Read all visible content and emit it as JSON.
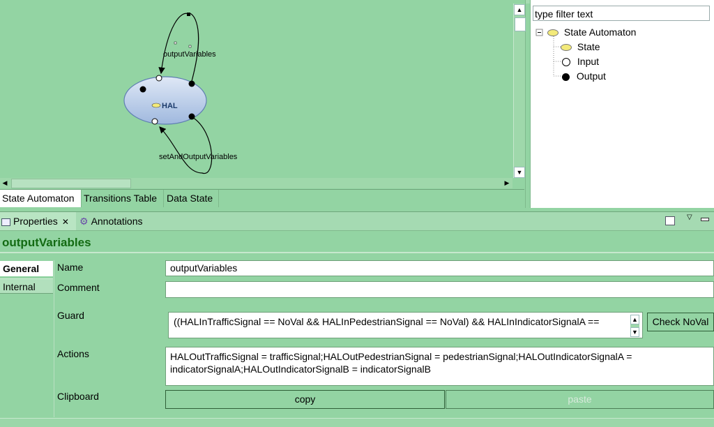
{
  "diagram": {
    "node_label": "HAL",
    "transition_top_label": "outputVariables",
    "transition_bottom_label": "setAndOutputVariables"
  },
  "editor_tabs": [
    "State Automaton",
    "Transitions Table",
    "Data State"
  ],
  "outline": {
    "filter_placeholder": "type filter text",
    "root": "State Automaton",
    "children": [
      "State",
      "Input",
      "Output"
    ],
    "toggle": "⊟"
  },
  "properties": {
    "tabs": [
      "Properties",
      "Annotations"
    ],
    "title": "outputVariables",
    "nav": [
      "General",
      "Internal"
    ],
    "labels": {
      "name": "Name",
      "comment": "Comment",
      "guard": "Guard",
      "actions": "Actions",
      "clipboard": "Clipboard"
    },
    "name_value": "outputVariables",
    "comment_value": "",
    "guard_value": "((HALInTrafficSignal == NoVal && HALInPedestrianSignal == NoVal) && HALInIndicatorSignalA ==",
    "actions_value": "HALOutTrafficSignal = trafficSignal;HALOutPedestrianSignal = pedestrianSignal;HALOutIndicatorSignalA = indicatorSignalA;HALOutIndicatorSignalB = indicatorSignalB",
    "check_button": "Check NoVal",
    "copy_button": "copy",
    "paste_button": "paste"
  },
  "colors": {
    "background": "#93d4a3",
    "title_green": "#136b13",
    "node_fill": "#b8cdeb"
  }
}
